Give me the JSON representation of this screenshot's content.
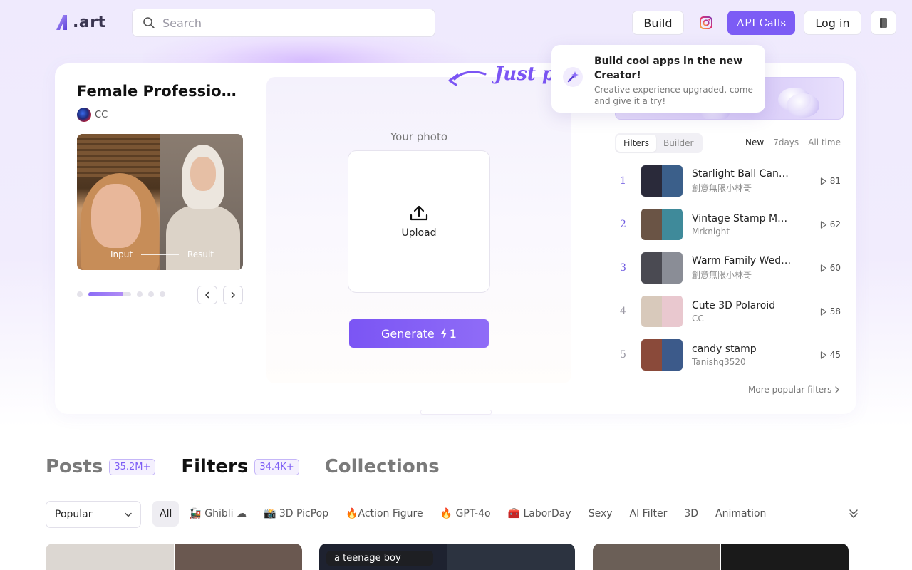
{
  "header": {
    "logo_text": ".art",
    "search_placeholder": "Search",
    "build_label": "Build",
    "api_label": "API Calls",
    "login_label": "Log in"
  },
  "popup": {
    "title": "Build cool apps in the new Creator!",
    "description": "Creative experience upgraded, come and give it a try!"
  },
  "featured": {
    "title": "Female Professional Portrait",
    "author": "CC",
    "input_label": "Input",
    "result_label": "Result",
    "carousel_progress": 0.8
  },
  "generator": {
    "handwritten_note": "Just pl",
    "photo_label": "Your photo",
    "upload_label": "Upload",
    "generate_label": "Generate",
    "cost": "1"
  },
  "ranking": {
    "tabs": [
      {
        "label": "Filters"
      },
      {
        "label": "Builder"
      }
    ],
    "time_tabs": [
      {
        "label": "New"
      },
      {
        "label": "7days"
      },
      {
        "label": "All time"
      }
    ],
    "items": [
      {
        "rank": "1",
        "title": "Starlight Ball Candid Moment",
        "author": "創意無限小林哥",
        "count": "81",
        "thumb": [
          "#2a2a3a",
          "#3b5f8a"
        ]
      },
      {
        "rank": "2",
        "title": "Vintage Stamp Memory",
        "author": "Mrknight",
        "count": "62",
        "thumb": [
          "#6a5445",
          "#3f8a9a"
        ]
      },
      {
        "rank": "3",
        "title": "Warm Family Wedding",
        "author": "創意無限小林哥",
        "count": "60",
        "thumb": [
          "#4a4a52",
          "#8a8d96"
        ]
      },
      {
        "rank": "4",
        "title": "Cute 3D Polaroid",
        "author": "CC",
        "count": "58",
        "thumb": [
          "#d8c9bb",
          "#e9c8cf"
        ]
      },
      {
        "rank": "5",
        "title": "candy stamp",
        "author": "Tanishq3520",
        "count": "45",
        "thumb": [
          "#8a4a3a",
          "#3c5a8a"
        ]
      }
    ],
    "more_label": "More popular filters"
  },
  "section": {
    "tabs": [
      {
        "label": "Posts",
        "count": "35.2M+"
      },
      {
        "label": "Filters",
        "count": "34.4K+"
      },
      {
        "label": "Collections",
        "count": ""
      }
    ],
    "sort_value": "Popular",
    "categories": [
      {
        "label": "All"
      },
      {
        "label": "🚂 Ghibli ☁"
      },
      {
        "label": "📸 3D PicPop"
      },
      {
        "label": "🔥Action Figure"
      },
      {
        "label": "🔥 GPT-4o"
      },
      {
        "label": "🧰 LaborDay"
      },
      {
        "label": "Sexy"
      },
      {
        "label": "AI Filter"
      },
      {
        "label": "3D"
      },
      {
        "label": "Animation"
      }
    ],
    "card_caption": "a teenage boy"
  },
  "colors": {
    "accent": "#7c5cf5",
    "rank_accent": "#6c58e0"
  }
}
